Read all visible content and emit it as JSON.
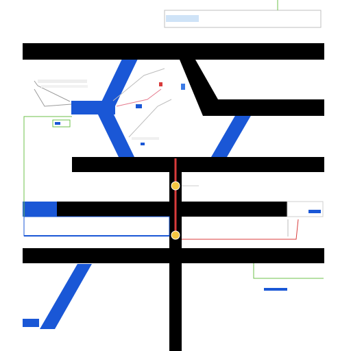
{
  "diagram": {
    "colors": {
      "background": "#ffffff",
      "bar": "#000000",
      "blue": "#1a57d6",
      "red": "#d83b3b",
      "green": "#6cc04a",
      "gray_line": "#9a9a9a",
      "node": "#f4c542"
    },
    "labels": {
      "top_box": "",
      "bar_1": "",
      "bar_4": "",
      "bar_5": "",
      "left_panel_1": "",
      "left_panel_2": "",
      "right_panel": "",
      "right_lower_box": "",
      "bottom_caption": "",
      "bottom_left_box": ""
    },
    "nodes": [
      {
        "id": "node-1",
        "label": ""
      },
      {
        "id": "node-2",
        "label": ""
      }
    ]
  }
}
